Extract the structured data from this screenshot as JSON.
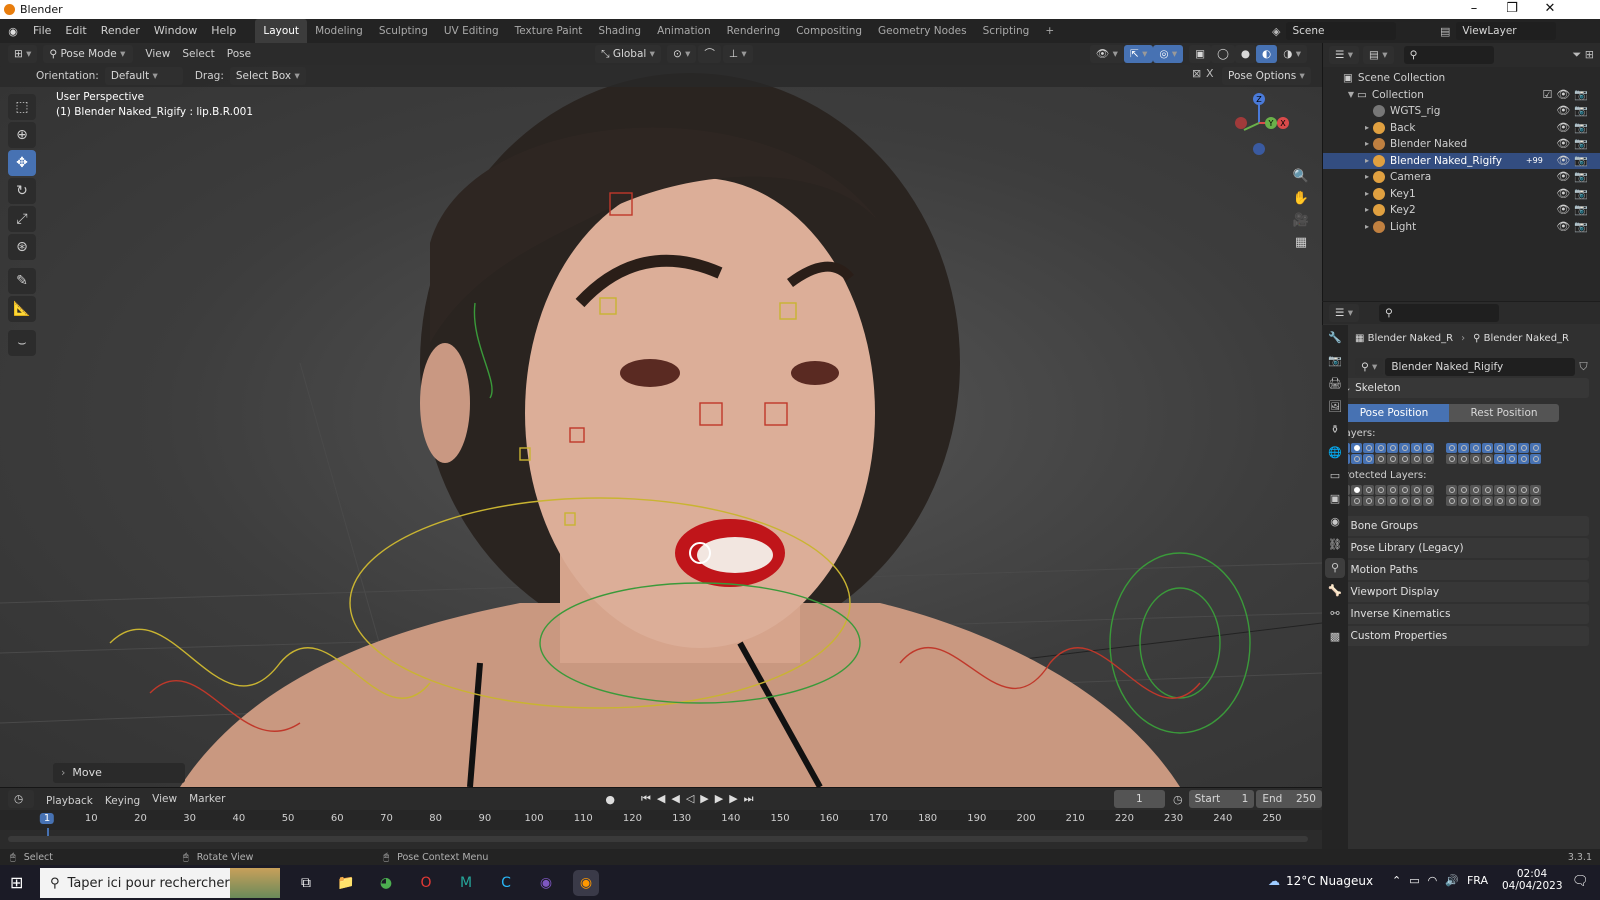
{
  "window": {
    "title": "Blender"
  },
  "menu": [
    "File",
    "Edit",
    "Render",
    "Window",
    "Help"
  ],
  "workspaces": [
    "Layout",
    "Modeling",
    "Sculpting",
    "UV Editing",
    "Texture Paint",
    "Shading",
    "Animation",
    "Rendering",
    "Compositing",
    "Geometry Nodes",
    "Scripting"
  ],
  "scene": {
    "name": "Scene",
    "view_layer": "ViewLayer"
  },
  "viewport_header": {
    "mode": "Pose Mode",
    "menus": [
      "View",
      "Select",
      "Pose"
    ],
    "transform_orientation": "Global",
    "orientation_label": "Orientation:",
    "orientation_value": "Default",
    "drag_label": "Drag:",
    "drag_value": "Select Box",
    "pose_options": "Pose Options"
  },
  "viewport": {
    "perspective": "User Perspective",
    "object_info": "(1) Blender Naked_Rigify : lip.B.R.001",
    "last_op": "Move"
  },
  "gizmo": {
    "z": "Z",
    "y": "Y",
    "x": "X"
  },
  "outliner": {
    "root": "Scene Collection",
    "collection": "Collection",
    "items": [
      {
        "name": "WGTS_rig",
        "color": "#777777",
        "selected": false
      },
      {
        "name": "Back",
        "color": "#e0a040",
        "selected": false
      },
      {
        "name": "Blender Naked",
        "color": "#c08040",
        "selected": false
      },
      {
        "name": "Blender Naked_Rigify",
        "color": "#e0a040",
        "selected": true
      },
      {
        "name": "Camera",
        "color": "#e0a040",
        "selected": false
      },
      {
        "name": "Key1",
        "color": "#e0a040",
        "selected": false
      },
      {
        "name": "Key2",
        "color": "#e0a040",
        "selected": false
      },
      {
        "name": "Light",
        "color": "#c08040",
        "selected": false
      }
    ],
    "badge": "+99"
  },
  "properties": {
    "breadcrumb_a": "Blender Naked_R",
    "breadcrumb_b": "Blender Naked_R",
    "datablock": "Blender Naked_Rigify",
    "skeleton": "Skeleton",
    "pose_position": "Pose Position",
    "rest_position": "Rest Position",
    "layers_label": "Layers:",
    "protected_label": "Protected Layers:",
    "panels": [
      "Bone Groups",
      "Pose Library (Legacy)",
      "Motion Paths",
      "Viewport Display",
      "Inverse Kinematics",
      "Custom Properties"
    ]
  },
  "timeline": {
    "menus": [
      "Playback",
      "Keying",
      "View",
      "Marker"
    ],
    "current_frame": "1",
    "start_label": "Start",
    "start": "1",
    "end_label": "End",
    "end": "250",
    "ticks": [
      "1",
      "10",
      "20",
      "30",
      "40",
      "50",
      "60",
      "70",
      "80",
      "90",
      "100",
      "110",
      "120",
      "130",
      "140",
      "150",
      "160",
      "170",
      "180",
      "190",
      "200",
      "210",
      "220",
      "230",
      "240",
      "250"
    ]
  },
  "statusbar": {
    "select": "Select",
    "rotate": "Rotate View",
    "context": "Pose Context Menu",
    "version": "3.3.1"
  },
  "taskbar": {
    "search_placeholder": "Taper ici pour rechercher",
    "weather": "12°C Nuageux",
    "lang": "FRA",
    "time": "02:04",
    "date": "04/04/2023"
  }
}
